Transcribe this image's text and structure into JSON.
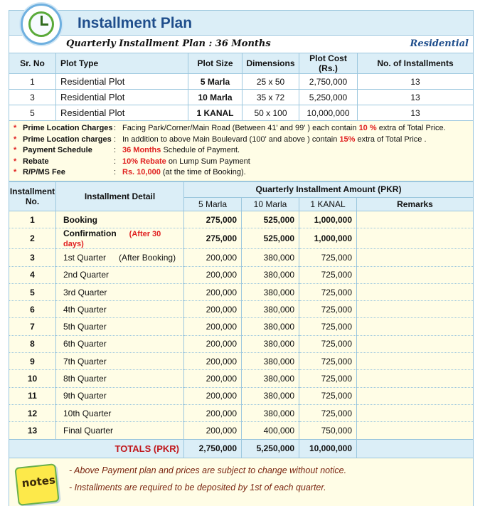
{
  "header": {
    "title": "Installment Plan",
    "subtitle": "Quarterly Installment Plan : 36 Months",
    "category": "Residential"
  },
  "plots": {
    "columns": [
      "Sr. No",
      "Plot Type",
      "Plot Size",
      "Dimensions",
      "Plot Cost (Rs.)",
      "No. of Installments"
    ],
    "rows": [
      [
        "1",
        "Residential Plot",
        "5 Marla",
        "25 x 50",
        "2,750,000",
        "13"
      ],
      [
        "3",
        "Residential Plot",
        "10 Marla",
        "35 x 72",
        "5,250,000",
        "13"
      ],
      [
        "5",
        "Residential Plot",
        "1 KANAL",
        "50 x 100",
        "10,000,000",
        "13"
      ]
    ]
  },
  "charges": [
    {
      "key": "Prime Location Charges",
      "pre": "Facing Park/Corner/Main Road (Between 41' and 99' ) each contain ",
      "hl": "10 %",
      "post": " extra of Total Price."
    },
    {
      "key": "Prime Location charges",
      "pre": "In addition to above Main Boulevard (100' and above ) contain ",
      "hl": "15%",
      "post": " extra of Total Price ."
    },
    {
      "key": "Payment Schedule",
      "pre": "",
      "hl": "36 Months",
      "post": " Schedule of Payment."
    },
    {
      "key": "Rebate",
      "pre": "",
      "hl": "10% Rebate",
      "post": " on Lump Sum Payment"
    },
    {
      "key": "R/P/MS Fee",
      "pre": "",
      "hl": "Rs. 10,000",
      "post": " (at the time of Booking)."
    }
  ],
  "installments": {
    "h_no": "Installment No.",
    "h_detail": "Installment Detail",
    "h_amount": "Quarterly Installment Amount (PKR)",
    "h_sizes": [
      "5 Marla",
      "10 Marla",
      "1 KANAL"
    ],
    "h_remarks": "Remarks",
    "rows": [
      {
        "no": "1",
        "detail": "Booking",
        "note": "",
        "a": "275,000",
        "b": "525,000",
        "c": "1,000,000",
        "bold": true,
        "red": false
      },
      {
        "no": "2",
        "detail": "Confirmation",
        "note": "(After 30 days)",
        "a": "275,000",
        "b": "525,000",
        "c": "1,000,000",
        "bold": true,
        "red": true
      },
      {
        "no": "3",
        "detail": "1st Quarter",
        "note": "(After Booking)",
        "a": "200,000",
        "b": "380,000",
        "c": "725,000",
        "bold": false,
        "red": false
      },
      {
        "no": "4",
        "detail": "2nd Quarter",
        "note": "",
        "a": "200,000",
        "b": "380,000",
        "c": "725,000",
        "bold": false,
        "red": false
      },
      {
        "no": "5",
        "detail": "3rd Quarter",
        "note": "",
        "a": "200,000",
        "b": "380,000",
        "c": "725,000",
        "bold": false,
        "red": false
      },
      {
        "no": "6",
        "detail": "4th Quarter",
        "note": "",
        "a": "200,000",
        "b": "380,000",
        "c": "725,000",
        "bold": false,
        "red": false
      },
      {
        "no": "7",
        "detail": "5th Quarter",
        "note": "",
        "a": "200,000",
        "b": "380,000",
        "c": "725,000",
        "bold": false,
        "red": false
      },
      {
        "no": "8",
        "detail": "6th Quarter",
        "note": "",
        "a": "200,000",
        "b": "380,000",
        "c": "725,000",
        "bold": false,
        "red": false
      },
      {
        "no": "9",
        "detail": "7th Quarter",
        "note": "",
        "a": "200,000",
        "b": "380,000",
        "c": "725,000",
        "bold": false,
        "red": false
      },
      {
        "no": "10",
        "detail": "8th Quarter",
        "note": "",
        "a": "200,000",
        "b": "380,000",
        "c": "725,000",
        "bold": false,
        "red": false
      },
      {
        "no": "11",
        "detail": "9th Quarter",
        "note": "",
        "a": "200,000",
        "b": "380,000",
        "c": "725,000",
        "bold": false,
        "red": false
      },
      {
        "no": "12",
        "detail": "10th Quarter",
        "note": "",
        "a": "200,000",
        "b": "380,000",
        "c": "725,000",
        "bold": false,
        "red": false
      },
      {
        "no": "13",
        "detail": "Final Quarter",
        "note": "",
        "a": "200,000",
        "b": "400,000",
        "c": "750,000",
        "bold": false,
        "red": false
      }
    ],
    "totals": {
      "label": "TOTALS  (PKR)",
      "a": "2,750,000",
      "b": "5,250,000",
      "c": "10,000,000"
    }
  },
  "notes": {
    "badge": "notes",
    "lines": [
      "- Above Payment plan and prices are subject to change without notice.",
      "- Installments are required to be deposited by 1st of each quarter."
    ]
  },
  "colors": {
    "header_bg": "#dbeef7",
    "body_bg": "#fffde6",
    "accent_red": "#e02020",
    "title_blue": "#1f4e8c"
  }
}
